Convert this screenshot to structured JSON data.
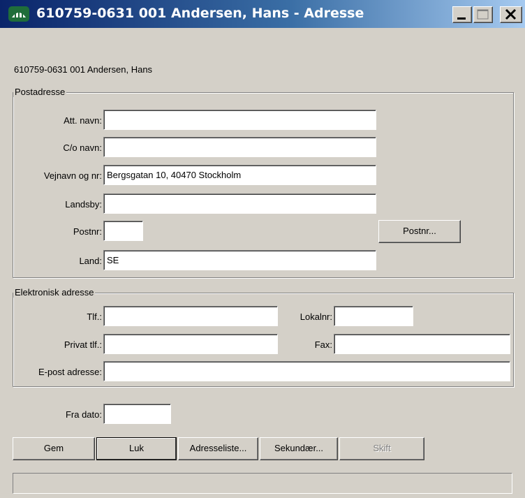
{
  "window": {
    "title": "610759-0631 001 Andersen, Hans - Adresse"
  },
  "header": {
    "person": "610759-0631 001 Andersen, Hans"
  },
  "postadresse": {
    "group_title": "Postadresse",
    "att_navn_label": "Att. navn:",
    "att_navn_value": "",
    "co_navn_label": "C/o navn:",
    "co_navn_value": "",
    "vejnavn_label": "Vejnavn og nr:",
    "vejnavn_value": "Bergsgatan 10, 40470 Stockholm",
    "landsby_label": "Landsby:",
    "landsby_value": "",
    "postnr_label": "Postnr:",
    "postnr_value": "",
    "postnr_button": "Postnr...",
    "land_label": "Land:",
    "land_value": "SE"
  },
  "elektronisk": {
    "group_title": "Elektronisk adresse",
    "tlf_label": "Tlf.:",
    "tlf_value": "",
    "lokalnr_label": "Lokalnr:",
    "lokalnr_value": "",
    "privat_tlf_label": "Privat tlf.:",
    "privat_tlf_value": "",
    "fax_label": "Fax:",
    "fax_value": "",
    "epost_label": "E-post adresse:",
    "epost_value": ""
  },
  "fra_dato": {
    "label": "Fra dato:",
    "value": ""
  },
  "buttons": {
    "gem": "Gem",
    "luk": "Luk",
    "adresseliste": "Adresseliste...",
    "sekundaer": "Sekundær...",
    "skift": "Skift"
  },
  "status": {
    "text": ""
  }
}
